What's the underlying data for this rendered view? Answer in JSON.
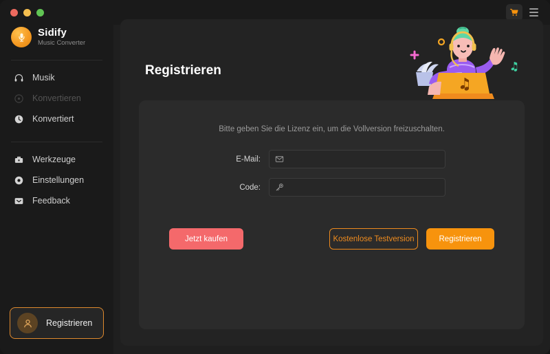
{
  "window": {
    "traffic_lights": [
      "close",
      "minimize",
      "maximize"
    ],
    "colors": {
      "close": "#ed6a5f",
      "minimize": "#f5bf4f",
      "maximize": "#61c554",
      "accent_orange": "#f7930d",
      "accent_coral": "#f4696b",
      "sidebar_bg": "#1a1a1a",
      "panel_bg": "#232323",
      "card_bg": "#2b2b2b"
    }
  },
  "brand": {
    "name": "Sidify",
    "subtitle": "Music Converter",
    "logo_icon": "microphone-icon"
  },
  "sidebar": {
    "primary_items": [
      {
        "label": "Musik",
        "icon": "headphones-icon",
        "state": "enabled"
      },
      {
        "label": "Konvertieren",
        "icon": "convert-icon",
        "state": "disabled"
      },
      {
        "label": "Konvertiert",
        "icon": "clock-icon",
        "state": "enabled"
      }
    ],
    "secondary_items": [
      {
        "label": "Werkzeuge",
        "icon": "toolbox-icon",
        "state": "enabled"
      },
      {
        "label": "Einstellungen",
        "icon": "gear-icon",
        "state": "enabled"
      },
      {
        "label": "Feedback",
        "icon": "mail-chevron-icon",
        "state": "enabled"
      }
    ],
    "register_button": {
      "label": "Registrieren",
      "icon": "user-avatar-icon"
    }
  },
  "titlebar": {
    "cart_icon": "shopping-cart-icon",
    "menu_icon": "hamburger-menu-icon"
  },
  "main": {
    "page_title": "Registrieren",
    "illustration": "person-with-laptop-illustration",
    "card": {
      "hint": "Bitte geben Sie die Lizenz ein, um die Vollversion freizuschalten.",
      "fields": [
        {
          "label": "E-Mail:",
          "icon": "envelope-icon",
          "value": "",
          "placeholder": ""
        },
        {
          "label": "Code:",
          "icon": "key-icon",
          "value": "",
          "placeholder": ""
        }
      ],
      "buttons": {
        "buy": "Jetzt kaufen",
        "trial": "Kostenlose Testversion",
        "register": "Registrieren"
      }
    }
  }
}
